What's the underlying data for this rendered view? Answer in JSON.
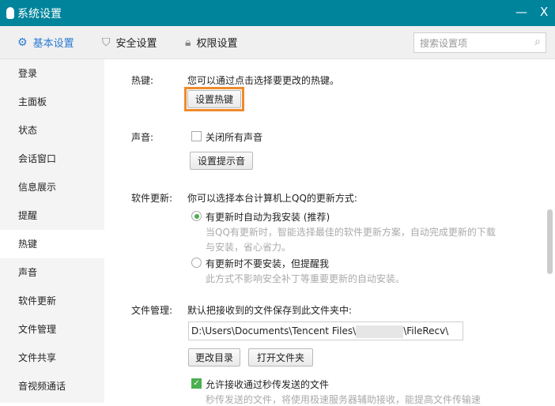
{
  "window": {
    "title": "系统设置",
    "minimize": "—",
    "close": "X"
  },
  "toolbar": {
    "tabs": [
      {
        "label": "基本设置",
        "icon": "gear-icon"
      },
      {
        "label": "安全设置",
        "icon": "shield-icon"
      },
      {
        "label": "权限设置",
        "icon": "lock-icon"
      }
    ],
    "search_placeholder": "搜索设置项"
  },
  "sidebar": {
    "items": [
      "登录",
      "主面板",
      "状态",
      "会话窗口",
      "信息展示",
      "提醒",
      "热键",
      "声音",
      "软件更新",
      "文件管理",
      "文件共享",
      "音视频通话"
    ],
    "active": "热键"
  },
  "hotkey": {
    "label": "热键:",
    "desc": "您可以通过点击选择要更改的热键。",
    "button": "设置热键"
  },
  "sound": {
    "label": "声音:",
    "mute_all": "关闭所有声音",
    "mute_checked": false,
    "button": "设置提示音"
  },
  "update": {
    "label": "软件更新:",
    "desc": "你可以选择本台计算机上QQ的更新方式:",
    "options": [
      {
        "label": "有更新时自动为我安装 (推荐)",
        "desc1": "当QQ有更新时，智能选择最佳的软件更新方案，自动完成更新的下载",
        "desc2": "与安装，省心省力。",
        "selected": true
      },
      {
        "label": "有更新时不要安装，但提醒我",
        "desc1": "此方式不影响安全补丁等重要更新的自动安装。",
        "selected": false
      }
    ]
  },
  "files": {
    "label": "文件管理:",
    "desc": "默认把接收到的文件保存到此文件夹中:",
    "path_prefix": "D:\\Users\\Documents\\Tencent Files\\",
    "path_suffix": "\\FileRecv\\",
    "change_button": "更改目录",
    "open_button": "打开文件夹",
    "allow_label": "允许接收通过秒传发送的文件",
    "allow_checked": true,
    "allow_desc": "秒传发送的文件，将使用极速服务器辅助接收，能提高文件传输速"
  },
  "colors": {
    "titlebar": "#00849c",
    "accent": "#2a7bd4",
    "highlight": "#f08a2c",
    "check": "#4caf50"
  }
}
